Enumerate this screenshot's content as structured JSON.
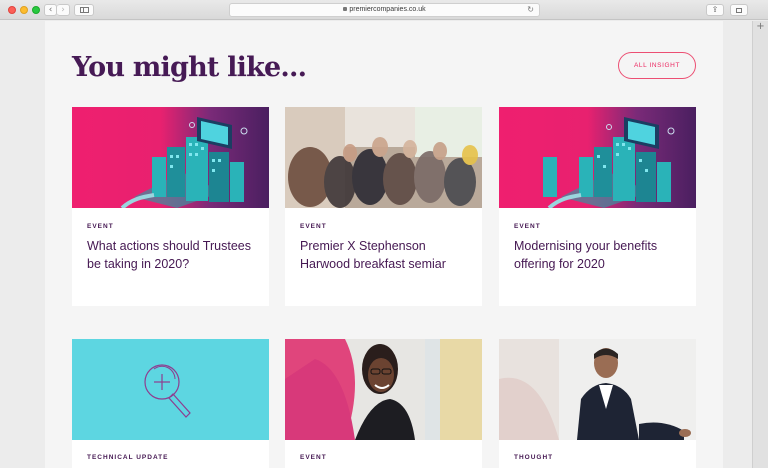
{
  "browser": {
    "url": "premiercompanies.co.uk"
  },
  "page": {
    "heading": "You might like...",
    "all_insight_label": "ALL INSIGHT"
  },
  "cards": [
    {
      "category": "EVENT",
      "title": "What actions should Trustees be taking in 2020?",
      "image": "isometric-city-illustration"
    },
    {
      "category": "EVENT",
      "title": "Premier X Stephenson Harwood breakfast semiar",
      "image": "seminar-audience-photo"
    },
    {
      "category": "EVENT",
      "title": "Modernising your benefits offering for 2020",
      "image": "isometric-city-illustration"
    },
    {
      "category": "TECHNICAL UPDATE",
      "title": "",
      "image": "magnifier-plus-icon"
    },
    {
      "category": "EVENT",
      "title": "",
      "image": "smiling-woman-photo"
    },
    {
      "category": "THOUGHT",
      "title": "",
      "image": "businessman-photo"
    }
  ],
  "colors": {
    "heading": "#461a55",
    "accent": "#ec2760",
    "teal": "#5dd6e1"
  }
}
